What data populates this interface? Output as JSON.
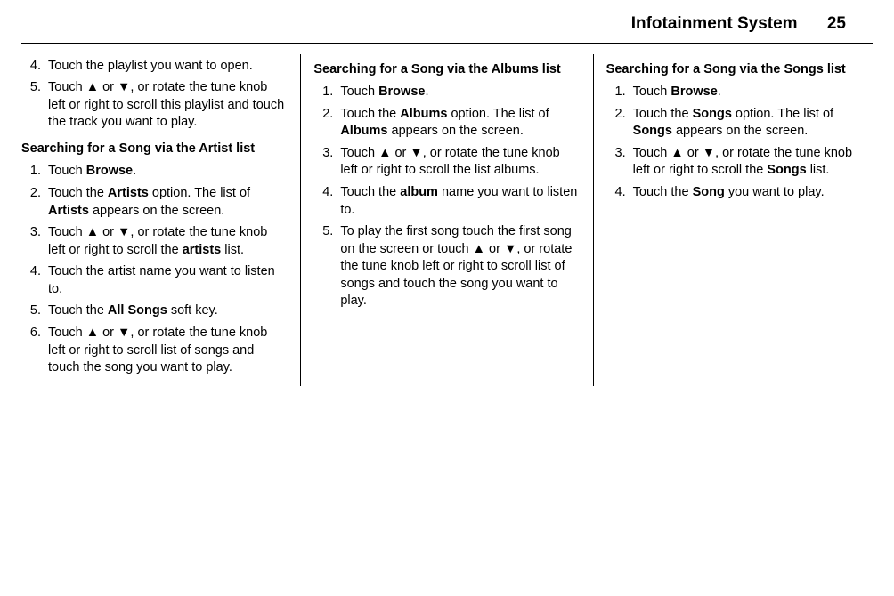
{
  "header": {
    "title": "Infotainment System",
    "page": "25"
  },
  "col1": {
    "list1": [
      {
        "n": "4.",
        "text": "Touch the playlist you want to open."
      },
      {
        "n": "5.",
        "pre": "Touch ",
        "up": "▲",
        "mid": " or ",
        "dn": "▼",
        "post": ", or rotate the tune knob left or right to scroll this playlist and touch the track you want to play."
      }
    ],
    "heading": "Searching for a Song via the Artist list",
    "list2": {
      "i1_pre": "Touch ",
      "i1_b": "Browse",
      "i1_post": ".",
      "i2_pre": "Touch the ",
      "i2_b1": "Artists",
      "i2_mid": " option. The list of ",
      "i2_b2": "Artists",
      "i2_post": " appears on the screen.",
      "i3_pre": "Touch ",
      "up": "▲",
      "or": " or ",
      "dn": "▼",
      "i3_mid": ", or rotate the tune knob left or right to scroll the ",
      "i3_b": "artists",
      "i3_post": " list.",
      "i4": "Touch the artist name you want to listen to.",
      "i5_pre": "Touch the ",
      "i5_b": "All Songs",
      "i5_post": " soft key.",
      "i6_pre": "Touch ",
      "i6_post": ", or rotate the tune knob left or right to scroll list of songs and touch the song you want to play."
    }
  },
  "col2": {
    "heading": "Searching for a Song via the Albums list",
    "i1_pre": "Touch ",
    "i1_b": "Browse",
    "i1_post": ".",
    "i2_pre": "Touch the ",
    "i2_b1": "Albums",
    "i2_mid": " option. The list of ",
    "i2_b2": "Albums",
    "i2_post": " appears on the screen.",
    "i3_pre": "Touch ",
    "up": "▲",
    "or": " or ",
    "dn": "▼",
    "i3_post": ", or rotate the tune knob left or right to scroll the list albums.",
    "i4_pre": "Touch the ",
    "i4_b": "album",
    "i4_post": " name you want to listen to.",
    "i5_pre": "To play the first song touch the first song on the screen or touch ",
    "i5_post": ", or rotate the tune knob left or right to scroll list of songs and touch the song you want to play."
  },
  "col3": {
    "heading": "Searching for a Song via the Songs list",
    "i1_pre": "Touch ",
    "i1_b": "Browse",
    "i1_post": ".",
    "i2_pre": "Touch the ",
    "i2_b1": "Songs",
    "i2_mid": " option. The list of ",
    "i2_b2": "Songs",
    "i2_post": " appears on the screen.",
    "i3_pre": "Touch ",
    "up": "▲",
    "or": " or ",
    "dn": "▼",
    "i3_mid": ", or rotate the tune knob left or right to scroll the ",
    "i3_b": "Songs",
    "i3_post": " list.",
    "i4_pre": "Touch the ",
    "i4_b": "Song",
    "i4_post": " you want to play."
  }
}
